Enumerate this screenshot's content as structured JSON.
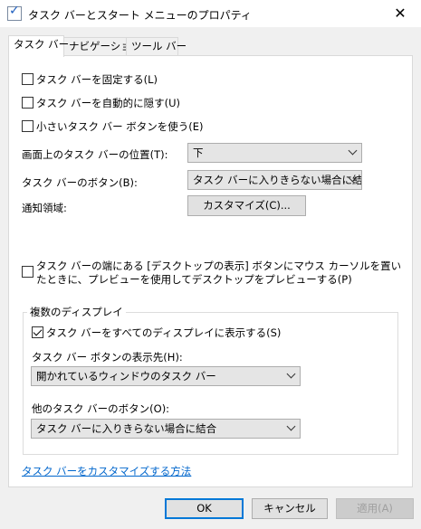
{
  "window": {
    "title": "タスク バーとスタート メニューのプロパティ",
    "close_glyph": "✕"
  },
  "tabs": [
    {
      "label": "タスク バー",
      "active": true
    },
    {
      "label": "ナビゲーション",
      "active": false
    },
    {
      "label": "ツール バー",
      "active": false
    }
  ],
  "options": {
    "lock": {
      "label": "タスク バーを固定する(L)",
      "checked": false
    },
    "autohide": {
      "label": "タスク バーを自動的に隠す(U)",
      "checked": false
    },
    "small_buttons": {
      "label": "小さいタスク バー ボタンを使う(E)",
      "checked": false
    }
  },
  "location": {
    "label": "画面上のタスク バーの位置(T):",
    "value": "下"
  },
  "buttons_combine": {
    "label": "タスク バーのボタン(B):",
    "value": "タスク バーに入りきらない場合に結合"
  },
  "notification": {
    "label": "通知領域:",
    "button": "カスタマイズ(C)..."
  },
  "peek": {
    "label": "タスク バーの端にある [デスクトップの表示] ボタンにマウス カーソルを置いたときに、プレビューを使用してデスクトップをプレビューする(P)",
    "checked": false
  },
  "multi_display": {
    "title": "複数のディスプレイ",
    "show_all": {
      "label": "タスク バーをすべてのディスプレイに表示する(S)",
      "checked": true
    },
    "show_buttons_on": {
      "label": "タスク バー ボタンの表示先(H):",
      "value": "開かれているウィンドウのタスク バー"
    },
    "other_buttons": {
      "label": "他のタスク バーのボタン(O):",
      "value": "タスク バーに入りきらない場合に結合"
    }
  },
  "help_link": "タスク バーをカスタマイズする方法",
  "footer": {
    "ok": "OK",
    "cancel": "キャンセル",
    "apply": "適用(A)"
  },
  "colors": {
    "link": "#0066cc",
    "default_button_border": "#0078d7"
  }
}
